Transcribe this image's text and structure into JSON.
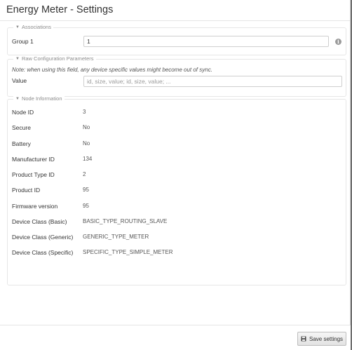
{
  "dialog": {
    "title": "Energy Meter - Settings"
  },
  "associations": {
    "legend": "Associations",
    "group1_label": "Group 1",
    "group1_value": "1"
  },
  "raw_config": {
    "legend": "Raw Configuration Parameters",
    "note": "Note: when using this field, any device specific values might become out of sync.",
    "value_label": "Value",
    "value_placeholder": "id, size, value; id, size, value; ..."
  },
  "node_info": {
    "legend": "Node Information",
    "rows": [
      {
        "label": "Node ID",
        "value": "3"
      },
      {
        "label": "Secure",
        "value": "No"
      },
      {
        "label": "Battery",
        "value": "No"
      },
      {
        "label": "Manufacturer ID",
        "value": "134"
      },
      {
        "label": "Product Type ID",
        "value": "2"
      },
      {
        "label": "Product ID",
        "value": "95"
      },
      {
        "label": "Firmware version",
        "value": "95"
      },
      {
        "label": "Device Class (Basic)",
        "value": "BASIC_TYPE_ROUTING_SLAVE"
      },
      {
        "label": "Device Class (Generic)",
        "value": "GENERIC_TYPE_METER"
      },
      {
        "label": "Device Class (Specific)",
        "value": "SPECIFIC_TYPE_SIMPLE_METER"
      }
    ]
  },
  "footer": {
    "save_label": "Save settings"
  },
  "icons": {
    "caret": "caret-down-icon",
    "info": "info-icon",
    "save": "floppy-disk-icon"
  }
}
